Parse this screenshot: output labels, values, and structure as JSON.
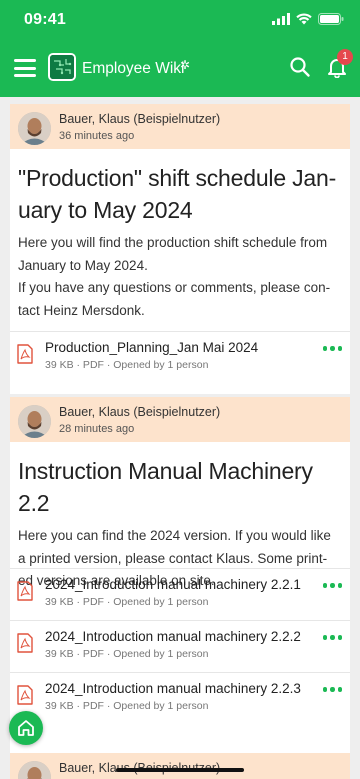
{
  "status_bar": {
    "time": "09:41"
  },
  "header": {
    "app_title": "Employee Wiki",
    "notification_count": "1",
    "colors": {
      "primary": "#1bb954",
      "badge": "#e5484d"
    },
    "icons": [
      "menu-icon",
      "app-logo-icon",
      "gear-icon",
      "search-icon",
      "bell-icon"
    ]
  },
  "posts": [
    {
      "author": "Bauer, Klaus (Beispielnutzer)",
      "time": "36 minutes ago",
      "title": "\"Production\" shift schedule Jan-uary to May 2024",
      "body": "Here you will find the production shift schedule from January to May 2024.",
      "body2": "If you have any questions or comments, please con-tact Heinz Mersdonk.",
      "attachments": [
        {
          "name": "Production_Planning_Jan Mai 2024",
          "meta": "39 KB · PDF · Opened by 1 person"
        }
      ]
    },
    {
      "author": "Bauer, Klaus (Beispielnutzer)",
      "time": "28 minutes ago",
      "title": "Instruction Manual Machinery 2.2",
      "body": "Here you can find the 2024 version. If you would like a printed version, please contact Klaus. Some print-ed versions are available on site.",
      "attachments": [
        {
          "name": "2024_Introduction manual machinery 2.2.1",
          "meta": "39 KB · PDF · Opened by 1 person"
        },
        {
          "name": "2024_Introduction manual machinery 2.2.2",
          "meta": "39 KB · PDF · Opened by 1 person"
        },
        {
          "name": "2024_Introduction manual machinery 2.2.3",
          "meta": "39 KB · PDF · Opened by 1 person"
        }
      ]
    },
    {
      "author": "Bauer, Klaus (Beispielnutzer)"
    }
  ]
}
